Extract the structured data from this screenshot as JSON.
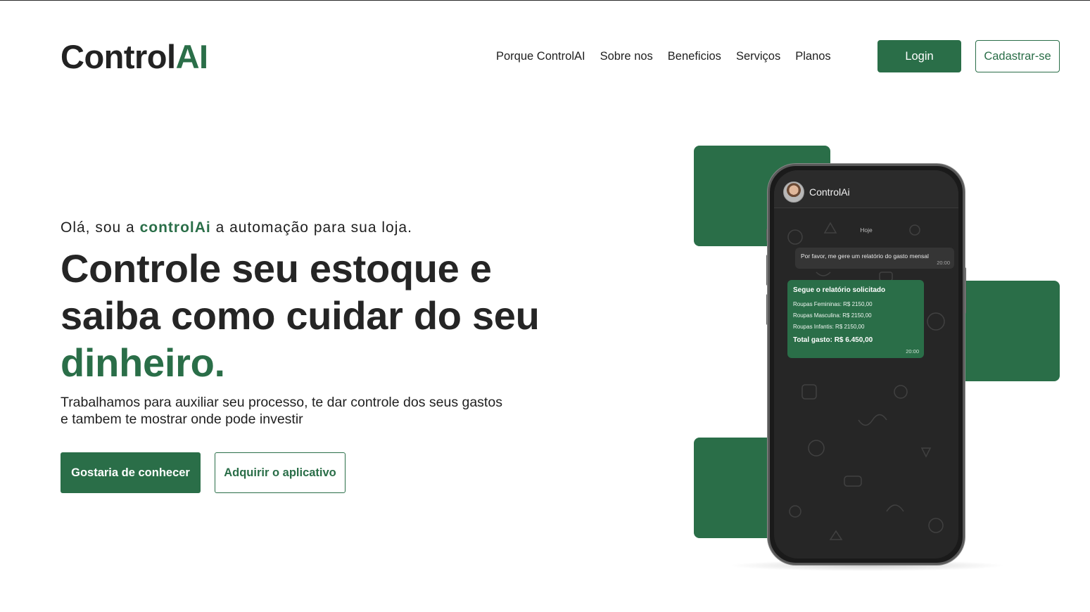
{
  "header": {
    "logo_main": "Control",
    "logo_accent": "AI",
    "nav": [
      "Porque ControlAI",
      "Sobre nos",
      "Beneficios",
      "Serviços",
      "Planos"
    ],
    "login_label": "Login",
    "signup_label": "Cadastrar-se"
  },
  "hero": {
    "greeting_before": "Olá, sou a ",
    "greeting_brand": "controlAi",
    "greeting_after": " a automação para sua loja.",
    "headline_main": "Controle seu estoque e saiba como cuidar do seu ",
    "headline_accent": "dinheiro.",
    "subtext_line1": "Trabalhamos para auxiliar seu processo, te dar controle dos seus gastos",
    "subtext_line2": "e tambem te mostrar onde pode investir",
    "primary_cta": "Gostaria de conhecer",
    "secondary_cta": "Adquirir o aplicativo"
  },
  "phone": {
    "contact_name": "ControlAi",
    "date_chip": "Hoje",
    "incoming": {
      "text": "Por favor, me gere um relatório do gasto mensal",
      "time": "20:00"
    },
    "outgoing": {
      "title": "Segue o relatório solicitado",
      "lines": [
        "Roupas Femininas: R$ 2150,00",
        "Roupas Masculina: R$ 2150,00",
        "Roupas Infantis: R$ 2150,00"
      ],
      "total": "Total gasto: R$ 6.450,00",
      "time": "20:00"
    }
  },
  "colors": {
    "accent": "#2a6e48",
    "text": "#1f1f1f",
    "phone_screen": "#262626"
  }
}
